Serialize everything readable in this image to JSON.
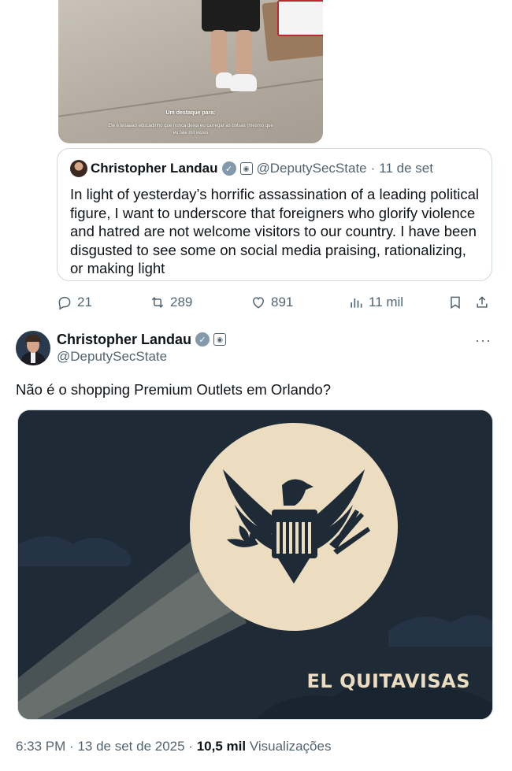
{
  "top_photo": {
    "caption_title": "Um destaque para:",
    "caption_body": "Ele é tesaaao educadinho que nunca deixa eu carregar as bolsas (mesmo que eu fale mil vezes"
  },
  "quoted_post": {
    "author_name": "Christopher Landau",
    "handle": "@DeputySecState",
    "separator": "·",
    "date": "11 de set",
    "text": "In light of yesterday’s horrific assassination of a leading political figure, I want to underscore that foreigners who glorify violence and hatred are not welcome visitors to our country. I have been disgusted to see some on social media praising, rationalizing, or making light"
  },
  "actions": {
    "replies": "21",
    "reposts": "289",
    "likes": "891",
    "views": "11 mil"
  },
  "post": {
    "author_name": "Christopher Landau",
    "handle": "@DeputySecState",
    "more": "···",
    "text": "Não é o shopping Premium Outlets em Orlando?",
    "media_label": "EL QUITAVISAS",
    "time": "6:33 PM",
    "date": "13 de set de 2025",
    "views_count": "10,5 mil",
    "views_label": "Visualizações",
    "separator": "·"
  },
  "colors": {
    "text": "#0f1419",
    "muted": "#536471",
    "border": "#cfd9de",
    "media_bg": "#1e2b37",
    "spotlight": "#ecdcc0",
    "eagle": "#1e2b37"
  },
  "icons": [
    "reply-icon",
    "repost-icon",
    "like-icon",
    "views-icon",
    "bookmark-icon",
    "share-icon",
    "verified-icon",
    "gov-badge-icon",
    "more-icon"
  ]
}
